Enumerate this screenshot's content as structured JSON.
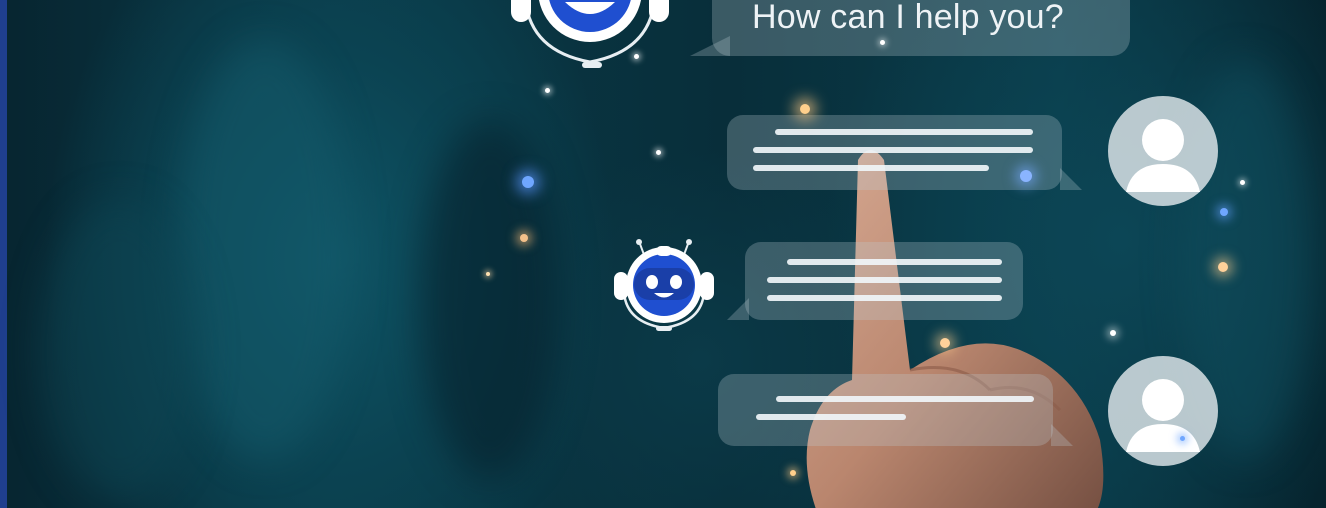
{
  "chat": {
    "greeting": "How can I help you?"
  },
  "colors": {
    "background": "#0a3a48",
    "bubble": "#bccbd2",
    "robot_blue": "#1f4fd0",
    "accent_bar": "#1f3f8e"
  },
  "icons": [
    "robot-icon",
    "user-icon"
  ]
}
